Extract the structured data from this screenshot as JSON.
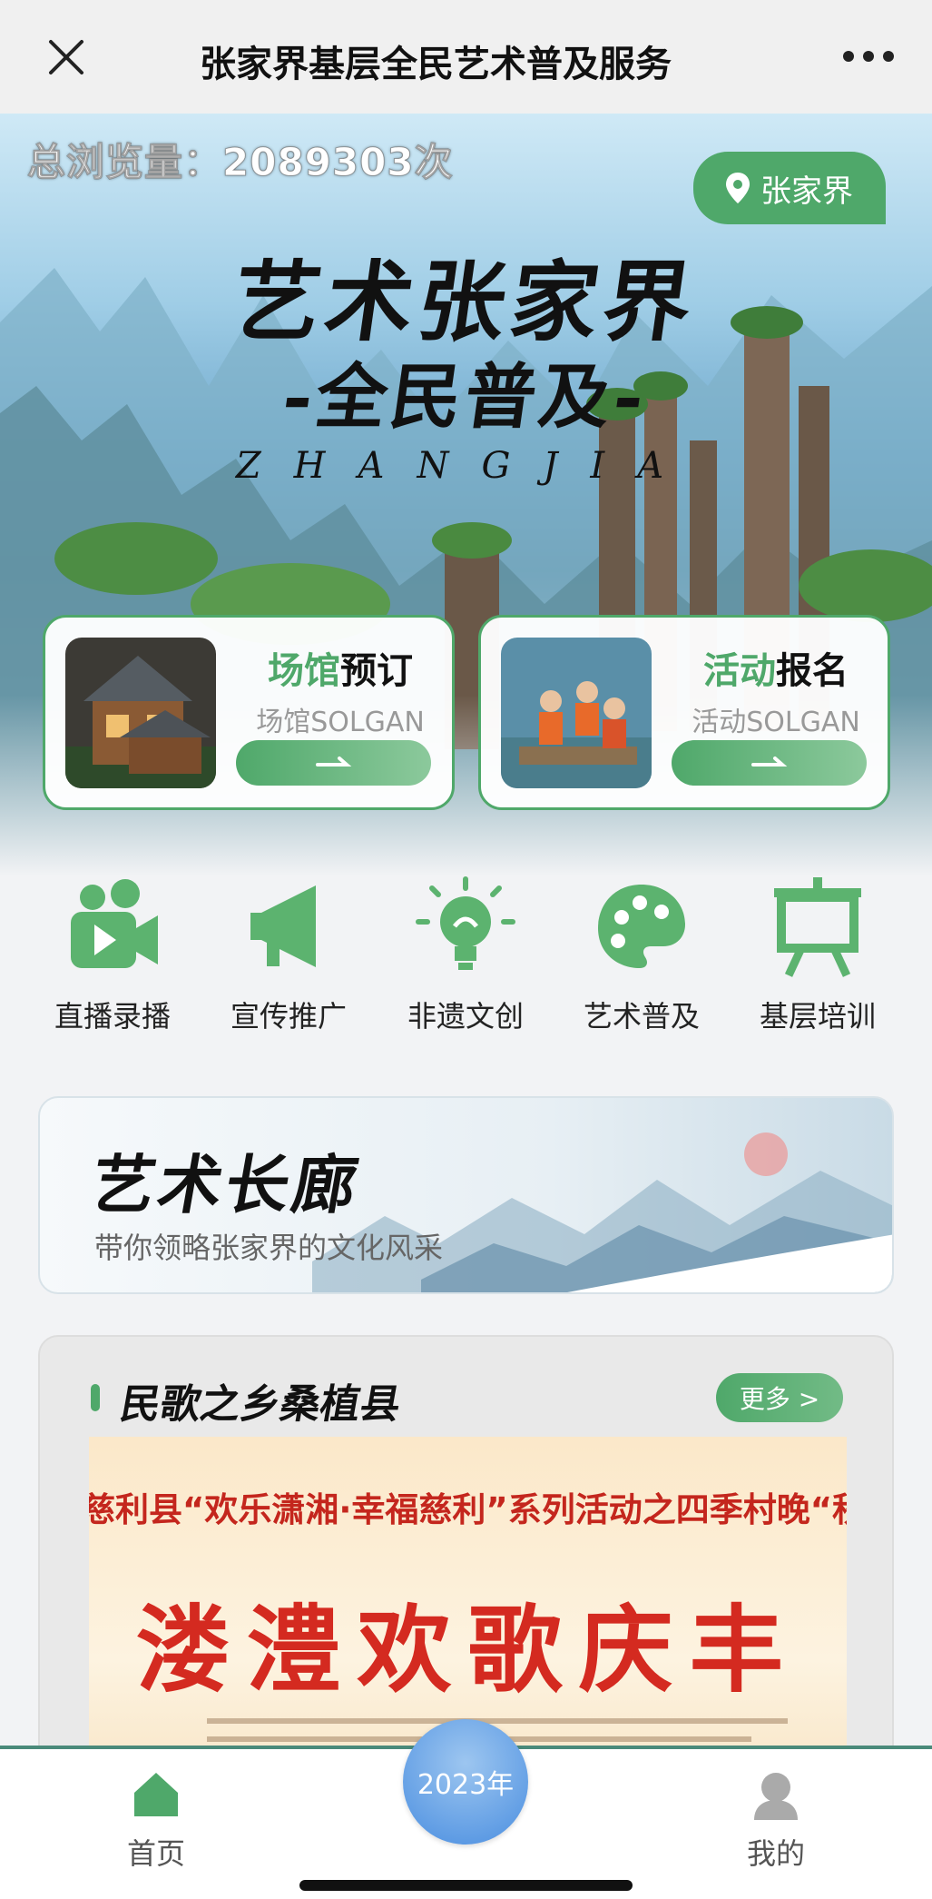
{
  "navbar": {
    "title": "张家界基层全民艺术普及服务",
    "close_icon": "close-icon",
    "more_icon": "more-dots-icon"
  },
  "hero": {
    "views_text": "总浏览量：2089303次",
    "location_label": "张家界",
    "location_icon": "map-pin-icon",
    "title_line1": "艺术张家界",
    "title_line2": "-全民普及-",
    "title_line3": "ZHANGJIA"
  },
  "cards": [
    {
      "title_highlight": "场馆",
      "title_rest": "预订",
      "subtitle": "场馆SOLGAN",
      "arrow_icon": "arrow-right-icon"
    },
    {
      "title_highlight": "活动",
      "title_rest": "报名",
      "subtitle": "活动SOLGAN",
      "arrow_icon": "arrow-right-icon"
    }
  ],
  "quick_nav": [
    {
      "label": "直播录播",
      "icon": "video-camera-icon"
    },
    {
      "label": "宣传推广",
      "icon": "megaphone-icon"
    },
    {
      "label": "非遗文创",
      "icon": "lightbulb-icon"
    },
    {
      "label": "艺术普及",
      "icon": "palette-icon"
    },
    {
      "label": "基层培训",
      "icon": "easel-icon"
    }
  ],
  "gallery": {
    "title": "艺术长廊",
    "subtitle": "带你领略张家界的文化风采"
  },
  "folk_section": {
    "title": "民歌之乡桑植县",
    "more_label": "更多 >",
    "poster_line1": "慈利县“欢乐潇湘·幸福慈利”系列活动之四季村晚“秋晚”",
    "poster_line2": "溇澧欢歌庆丰收"
  },
  "tabbar": {
    "home_label": "首页",
    "year_label": "2023年",
    "mine_label": "我的"
  },
  "colors": {
    "accent": "#4fa86a",
    "year_button": "#4a8ee0",
    "poster_red": "#d42a20"
  }
}
